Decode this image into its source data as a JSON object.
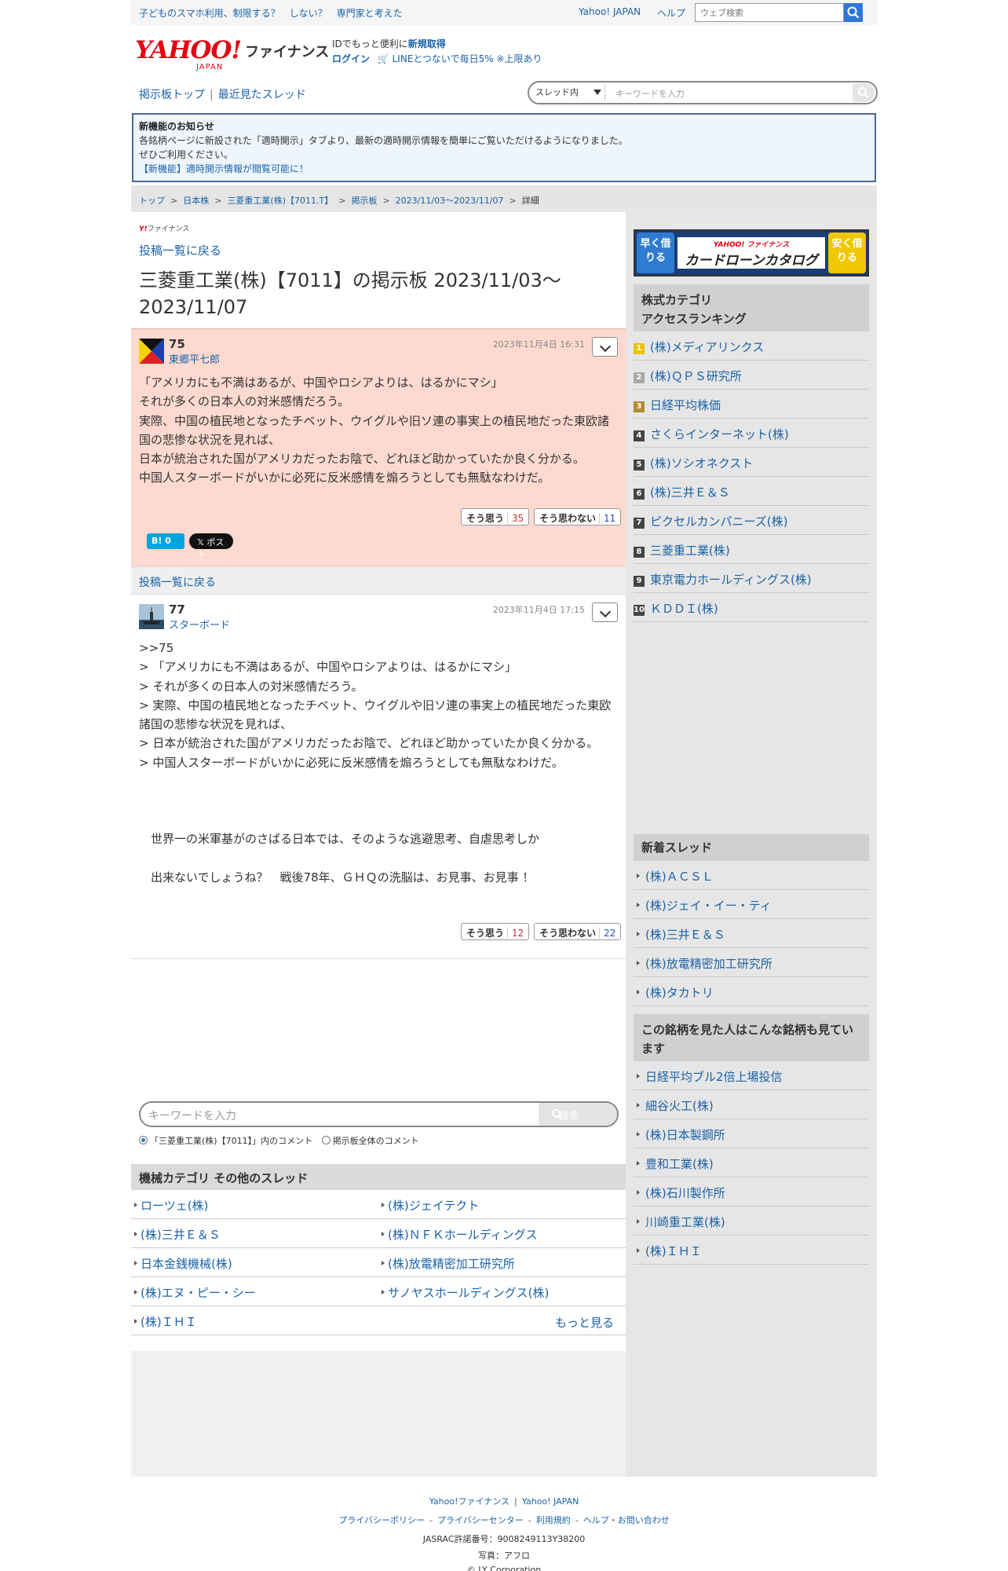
{
  "topbar": {
    "promo": "子どものスマホ利用、制限する？　しない？　専門家と考えた",
    "yahoo_japan": "Yahoo! JAPAN",
    "help": "ヘルプ",
    "search_placeholder": "ウェブ検索"
  },
  "logo": {
    "yahoo": "YAHOO!",
    "japan": "JAPAN",
    "finance": "ファイナンス"
  },
  "login": {
    "line1_prefix": "IDでもっと便利に",
    "line1_link": "新規取得",
    "login_label": "ログイン",
    "line_promo": "LINEとつないで毎日5% ※上限あり"
  },
  "nav": {
    "top": "掲示板トップ",
    "recent": "最近見たスレッド"
  },
  "thread_search": {
    "scope": "スレッド内",
    "placeholder": "キーワードを入力"
  },
  "notice": {
    "title": "新機能のお知らせ",
    "line1": "各銘柄ページに新設された「適時開示」タブより、最新の適時開示情報を簡単にご覧いただけるようになりました。",
    "line2": "ぜひご利用ください。",
    "line3": "【新機能】適時開示情報が閲覧可能に！"
  },
  "breadcrumb": {
    "items": [
      "トップ",
      "日本株",
      "三菱重工業(株)【7011.T】",
      "掲示板",
      "2023/11/03〜2023/11/07"
    ],
    "current": "詳細"
  },
  "main": {
    "small_logo_y": "Y!",
    "small_logo_text": "ファイナンス",
    "back": "投稿一覧に戻る",
    "title": "三菱重工業(株)【7011】の掲示板 2023/11/03〜2023/11/07"
  },
  "posts": [
    {
      "number": "75",
      "user": "東郷平七郎",
      "date": "2023年11月4日 16:31",
      "body": "「アメリカにも不満はあるが、中国やロシアよりは、はるかにマシ」\nそれが多くの日本人の対米感情だろう。\n実際、中国の植民地となったチベット、ウイグルや旧ソ連の事実上の植民地だった東欧諸国の悲惨な状況を見れば、\n日本が統治された国がアメリカだったお陰で、どれほど助かっていたか良く分かる。\n中国人スターボードがいかに必死に反米感情を煽ろうとしても無駄なわけだ。",
      "agree_label": "そう思う",
      "agree_count": "35",
      "disagree_label": "そう思わない",
      "disagree_count": "11"
    },
    {
      "number": "77",
      "user": "スターボード",
      "date": "2023年11月4日 17:15",
      "body": ">>75\n> 「アメリカにも不満はあるが、中国やロシアよりは、はるかにマシ」\n> それが多くの日本人の対米感情だろう。\n> 実際、中国の植民地となったチベット、ウイグルや旧ソ連の事実上の植民地だった東欧諸国の悲惨な状況を見れば、\n> 日本が統治された国がアメリカだったお陰で、どれほど助かっていたか良く分かる。\n> 中国人スターボードがいかに必死に反米感情を煽ろうとしても無駄なわけだ。\n\n\n\n　世界一の米軍基がのさばる日本では、そのような逃避思考、自虐思考しか\n\n　出来ないでしょうね？　戦後78年、ＧＨＱの洗脳は、お見事、お見事 ！",
      "agree_label": "そう思う",
      "agree_count": "12",
      "disagree_label": "そう思わない",
      "disagree_count": "22"
    }
  ],
  "share": {
    "hatena": "B! 0",
    "x": "𝕏 ポスト"
  },
  "back2": "投稿一覧に戻る",
  "kw_search": {
    "placeholder": "キーワードを入力",
    "button": "検索",
    "radio1": "「三菱重工業(株)【7011】」内のコメント",
    "radio2": "掲示板全体のコメント"
  },
  "other_threads": {
    "title": "機械カテゴリ  その他のスレッド",
    "items": [
      "ローツェ(株)",
      "(株)ジェイテクト",
      "(株)三井Ｅ＆Ｓ",
      "(株)ＮＦＫホールディングス",
      "日本金銭機械(株)",
      "(株)放電精密加工研究所",
      "(株)エヌ・ピー・シー",
      "サノヤスホールディングス(株)",
      "(株)ＩＨＩ"
    ],
    "more": "もっと見る"
  },
  "ad": {
    "left": "早く借りる",
    "right": "安く借りる",
    "brand": "YAHOO! ファイナンス",
    "catalog": "カードローンカタログ"
  },
  "ranking": {
    "title1": "株式カテゴリ",
    "title2": "アクセスランキング",
    "items": [
      {
        "rank": "1",
        "name": "(株)メディアリンクス",
        "color": "#e8c300"
      },
      {
        "rank": "2",
        "name": "(株)ＱＰＳ研究所",
        "color": "#a8a8a8"
      },
      {
        "rank": "3",
        "name": "日経平均株価",
        "color": "#b48a2c"
      },
      {
        "rank": "4",
        "name": "さくらインターネット(株)",
        "color": "#444444"
      },
      {
        "rank": "5",
        "name": "(株)ソシオネクスト",
        "color": "#444444"
      },
      {
        "rank": "6",
        "name": "(株)三井Ｅ＆Ｓ",
        "color": "#444444"
      },
      {
        "rank": "7",
        "name": "ピクセルカンパニーズ(株)",
        "color": "#444444"
      },
      {
        "rank": "8",
        "name": "三菱重工業(株)",
        "color": "#444444"
      },
      {
        "rank": "9",
        "name": "東京電力ホールディングス(株)",
        "color": "#444444"
      },
      {
        "rank": "10",
        "name": "ＫＤＤＩ(株)",
        "color": "#444444"
      }
    ]
  },
  "new_threads": {
    "title": "新着スレッド",
    "items": [
      "(株)ＡＣＳＬ",
      "(株)ジェイ・イー・ティ",
      "(株)三井Ｅ＆Ｓ",
      "(株)放電精密加工研究所",
      "(株)タカトリ"
    ]
  },
  "also_viewed": {
    "title": "この銘柄を見た人はこんな銘柄も見ています",
    "items": [
      "日経平均ブル2倍上場投信",
      "細谷火工(株)",
      "(株)日本製鋼所",
      "豊和工業(株)",
      "(株)石川製作所",
      "川崎重工業(株)",
      "(株)ＩＨＩ"
    ]
  },
  "footer": {
    "fin": "Yahoo!ファイナンス",
    "yj": "Yahoo! JAPAN",
    "links": [
      "プライバシーポリシー",
      "プライバシーセンター",
      "利用規約",
      "ヘルプ・お問い合わせ"
    ],
    "jasrac": "JASRAC許諾番号：9008249113Y38200",
    "photo": "写真：アフロ",
    "copyright": "© LY Corporation"
  }
}
